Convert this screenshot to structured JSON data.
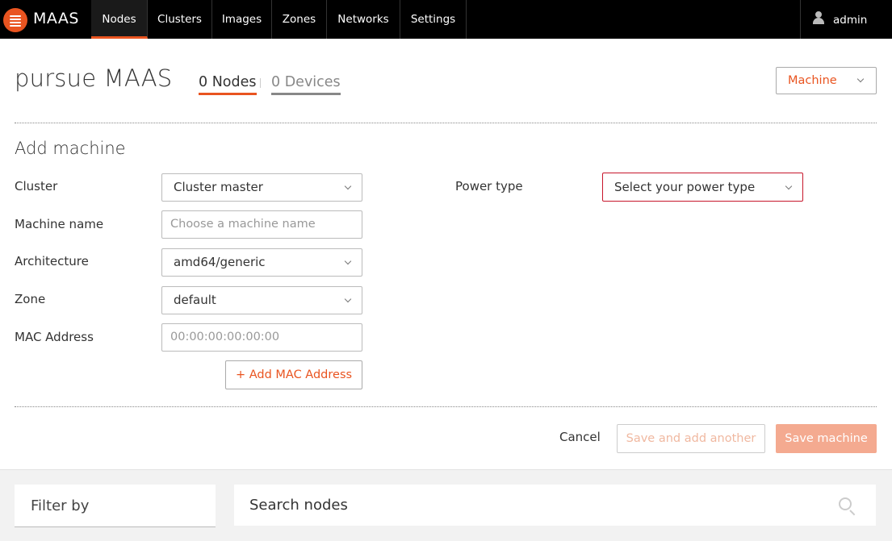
{
  "nav": {
    "brand": "MAAS",
    "items": [
      {
        "label": "Nodes",
        "active": true
      },
      {
        "label": "Clusters"
      },
      {
        "label": "Images"
      },
      {
        "label": "Zones"
      },
      {
        "label": "Networks"
      },
      {
        "label": "Settings"
      }
    ],
    "user": "admin"
  },
  "header": {
    "title": "pursue MAAS",
    "tabs": {
      "nodes": "0 Nodes",
      "devices": "0 Devices"
    },
    "type_select": "Machine"
  },
  "form": {
    "title": "Add machine",
    "cluster_label": "Cluster",
    "cluster_value": "Cluster master",
    "name_label": "Machine name",
    "name_placeholder": "Choose a machine name",
    "arch_label": "Architecture",
    "arch_value": "amd64/generic",
    "zone_label": "Zone",
    "zone_value": "default",
    "mac_label": "MAC Address",
    "mac_placeholder": "00:00:00:00:00:00",
    "add_mac": "+ Add MAC Address",
    "power_label": "Power type",
    "power_value": "Select your power type",
    "cancel": "Cancel",
    "save_another": "Save and add another",
    "save": "Save machine"
  },
  "bottom": {
    "filter_title": "Filter by",
    "search_placeholder": "Search nodes"
  },
  "colors": {
    "accent": "#e95420",
    "error": "#c7162b",
    "nav_bg": "#000000"
  }
}
